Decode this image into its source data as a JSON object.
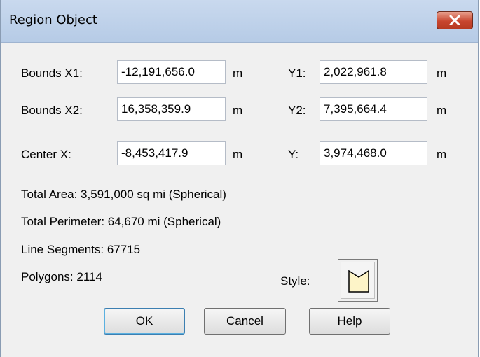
{
  "window": {
    "title": "Region Object"
  },
  "bounds": {
    "x1_label": "Bounds X1:",
    "x1_value": "-12,191,656.0",
    "x1_unit": "m",
    "y1_label": "Y1:",
    "y1_value": "2,022,961.8",
    "y1_unit": "m",
    "x2_label": "Bounds X2:",
    "x2_value": "16,358,359.9",
    "x2_unit": "m",
    "y2_label": "Y2:",
    "y2_value": "7,395,664.4",
    "y2_unit": "m"
  },
  "center": {
    "x_label": "Center X:",
    "x_value": "-8,453,417.9",
    "x_unit": "m",
    "y_label": "Y:",
    "y_value": "3,974,468.0",
    "y_unit": "m"
  },
  "stats": {
    "total_area": "Total Area:  3,591,000 sq mi (Spherical)",
    "total_perimeter": "Total Perimeter:  64,670 mi (Spherical)",
    "line_segments": "Line Segments:  67715",
    "polygons": "Polygons:  2114"
  },
  "style": {
    "label": "Style:",
    "fill_color": "#fdf4c8"
  },
  "buttons": {
    "ok": "OK",
    "cancel": "Cancel",
    "help": "Help"
  },
  "icons": {
    "close": "close-icon",
    "style_swatch": "region-style-icon"
  }
}
